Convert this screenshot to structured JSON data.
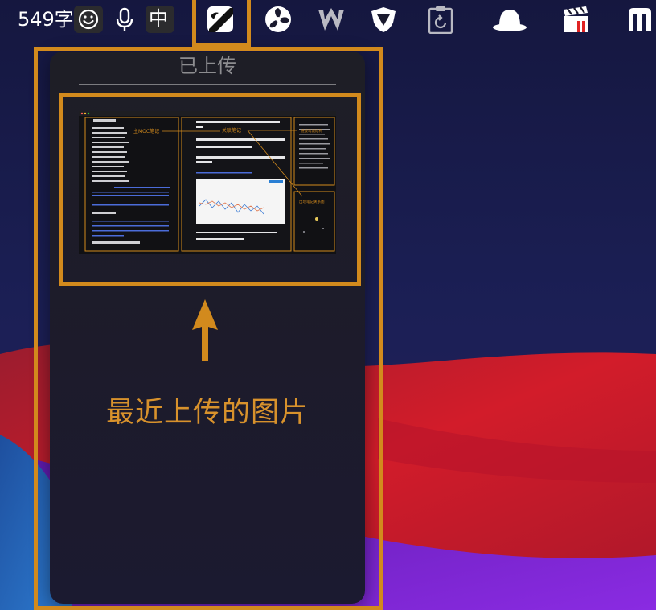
{
  "menubar": {
    "word_count": "549字",
    "input_method": "中",
    "icons": [
      "emoji-icon",
      "microphone-icon",
      "input-method-icon",
      "app-active-icon",
      "fan-icon",
      "w-app-icon",
      "shield-app-icon",
      "clipboard-history-icon",
      "bowler-hat-icon",
      "clapperboard-icon",
      "m-app-icon"
    ]
  },
  "panel": {
    "title": "已上传",
    "caption": "最近上传的图片"
  },
  "thumbnail": {
    "labels": {
      "main_moc": "主MOC笔记",
      "related": "关联笔记",
      "link_note": "链接笔记结构",
      "outline": "出现笔记关系图"
    }
  },
  "colors": {
    "highlight": "#d28a1d",
    "caption": "#d8922c",
    "panel_title": "#8d8d90"
  }
}
